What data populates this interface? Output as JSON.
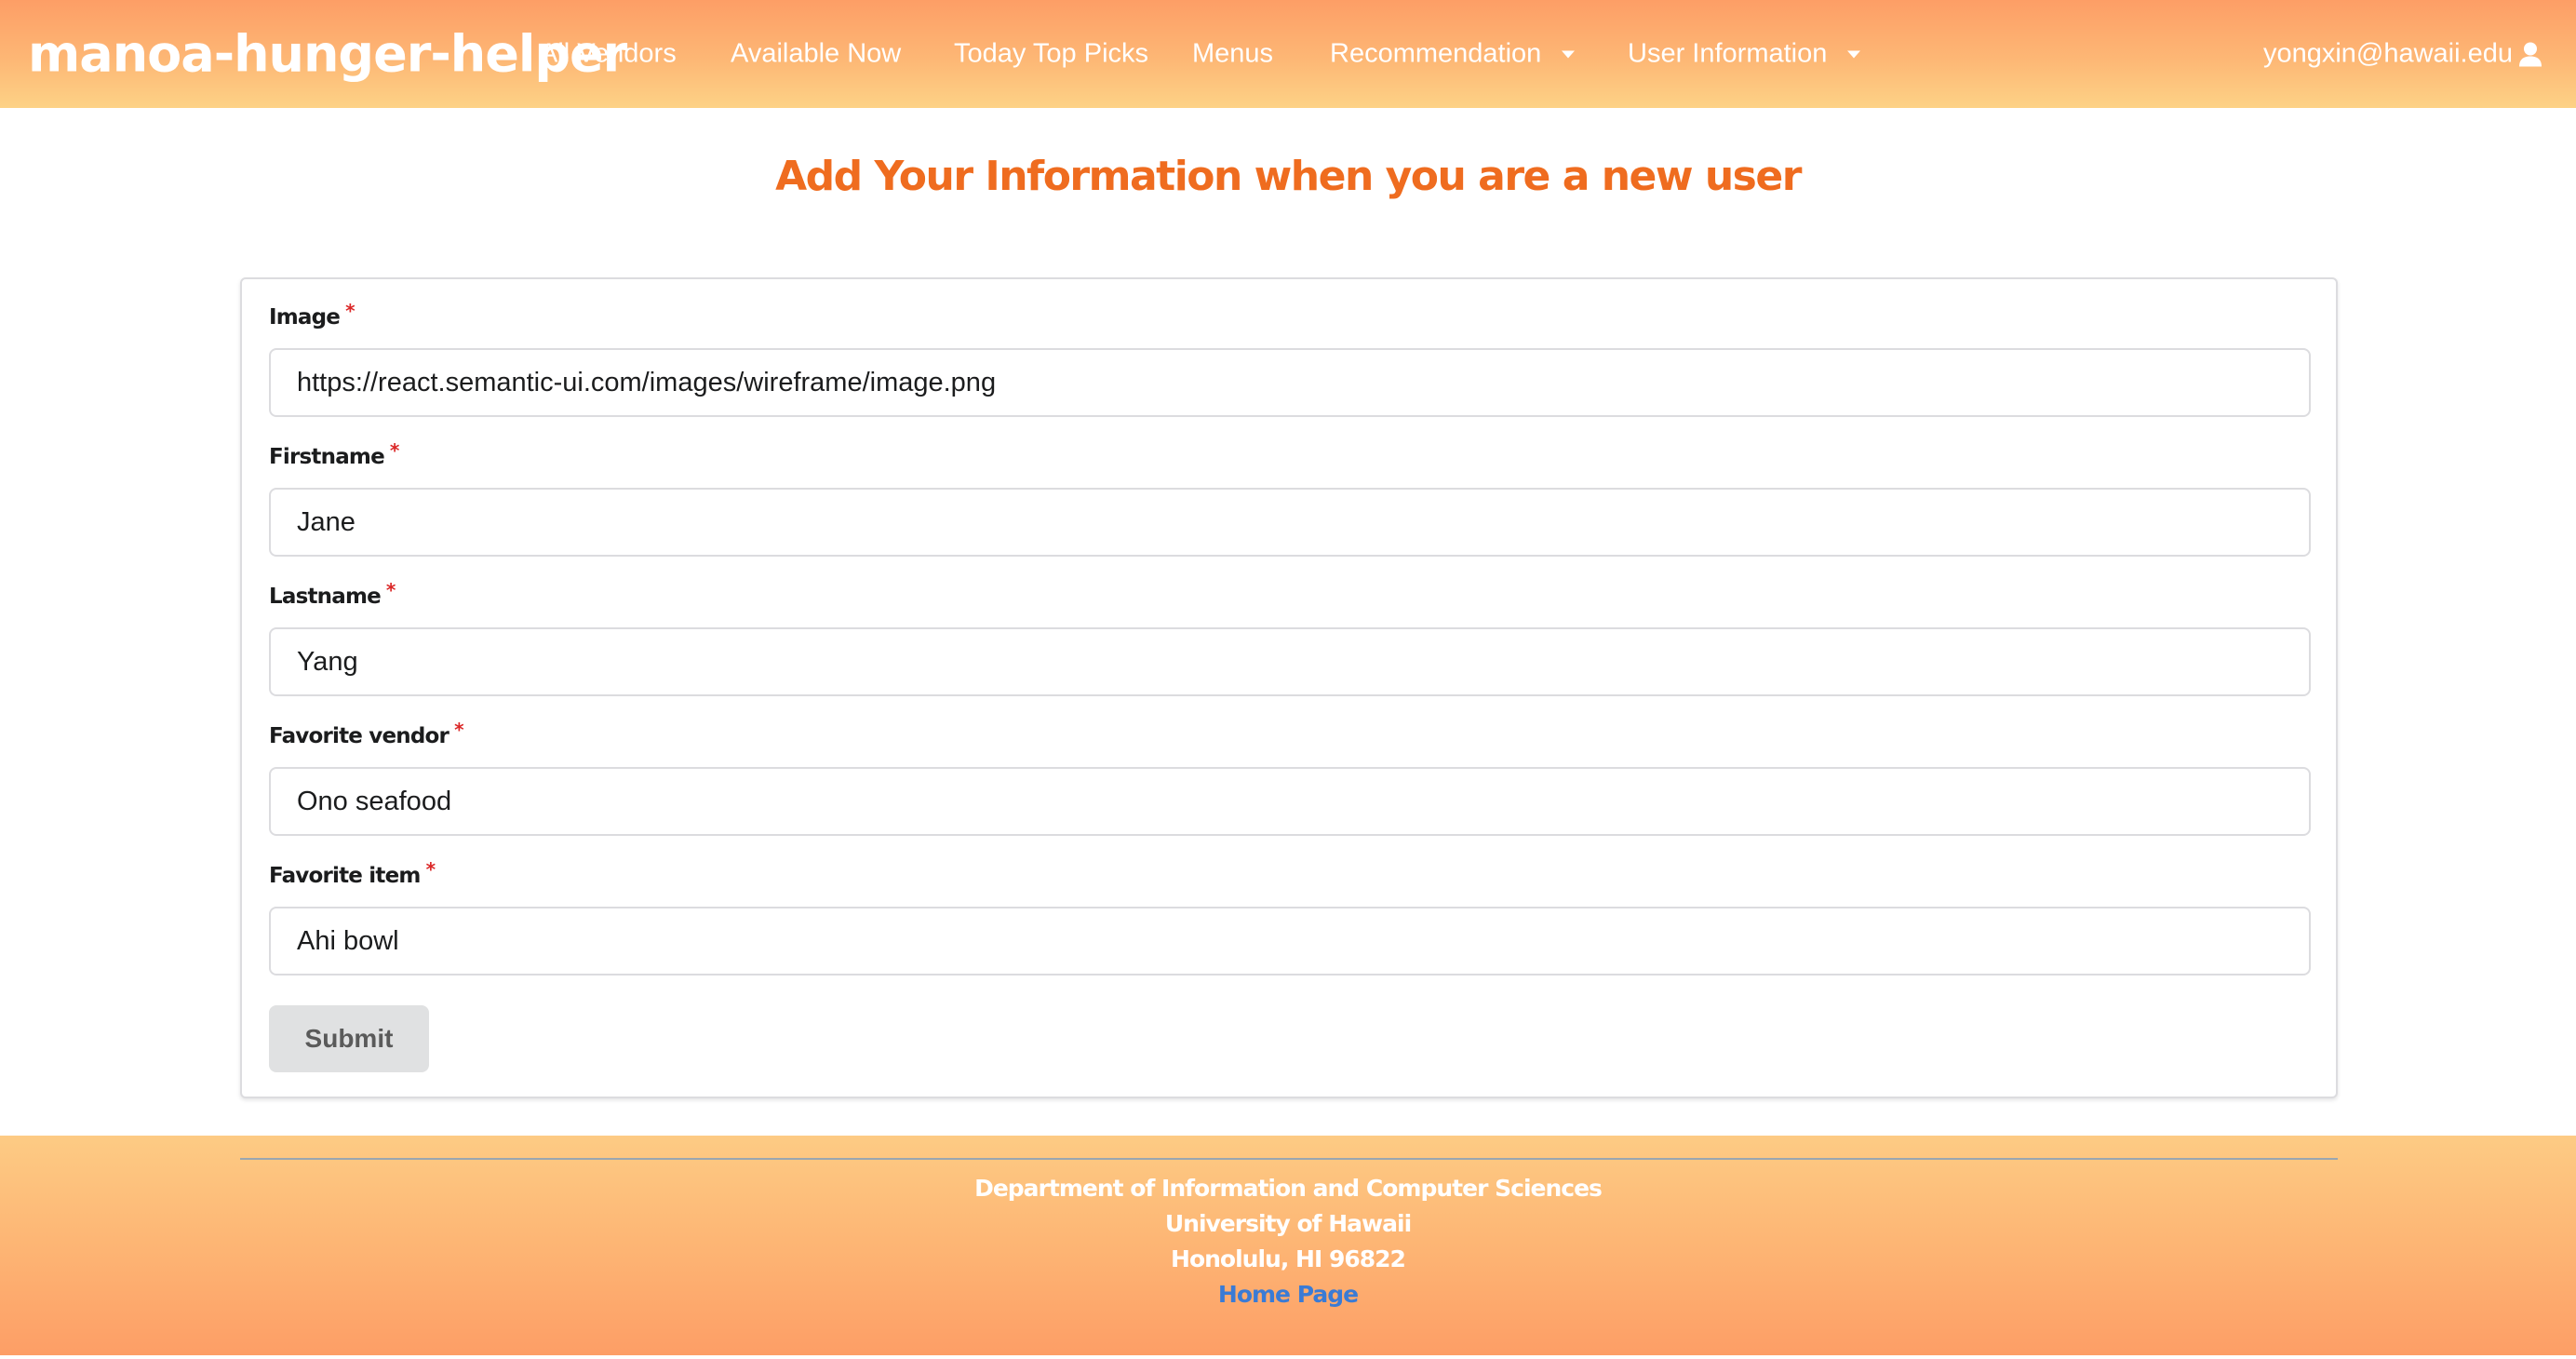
{
  "navbar": {
    "brand": "manoa-hunger-helper",
    "items": [
      {
        "label": "All Vendors"
      },
      {
        "label": "Available Now"
      },
      {
        "label": "Today Top Picks"
      },
      {
        "label": "Menus"
      },
      {
        "label": "Recommendation",
        "dropdown": true
      },
      {
        "label": "User Information",
        "dropdown": true
      }
    ],
    "user_email": "yongxin@hawaii.edu",
    "user_icon": "user-icon"
  },
  "page": {
    "title": "Add Your Information when you are a new user"
  },
  "form": {
    "required_marker": "*",
    "fields": [
      {
        "label": "Image",
        "value": "https://react.semantic-ui.com/images/wireframe/image.png"
      },
      {
        "label": "Firstname",
        "value": "Jane"
      },
      {
        "label": "Lastname",
        "value": "Yang"
      },
      {
        "label": "Favorite vendor",
        "value": "Ono seafood"
      },
      {
        "label": "Favorite item",
        "value": "Ahi bowl"
      }
    ],
    "submit_label": "Submit"
  },
  "footer": {
    "line1": "Department of Information and Computer Sciences",
    "line2": "University of Hawaii",
    "line3": "Honolulu, HI 96822",
    "link": "Home Page"
  },
  "colors": {
    "accent": "#ef6c1f",
    "navbar_top": "#fd9e66",
    "navbar_bottom": "#fdd286",
    "link": "#3a7bd5",
    "required": "#db2828"
  }
}
